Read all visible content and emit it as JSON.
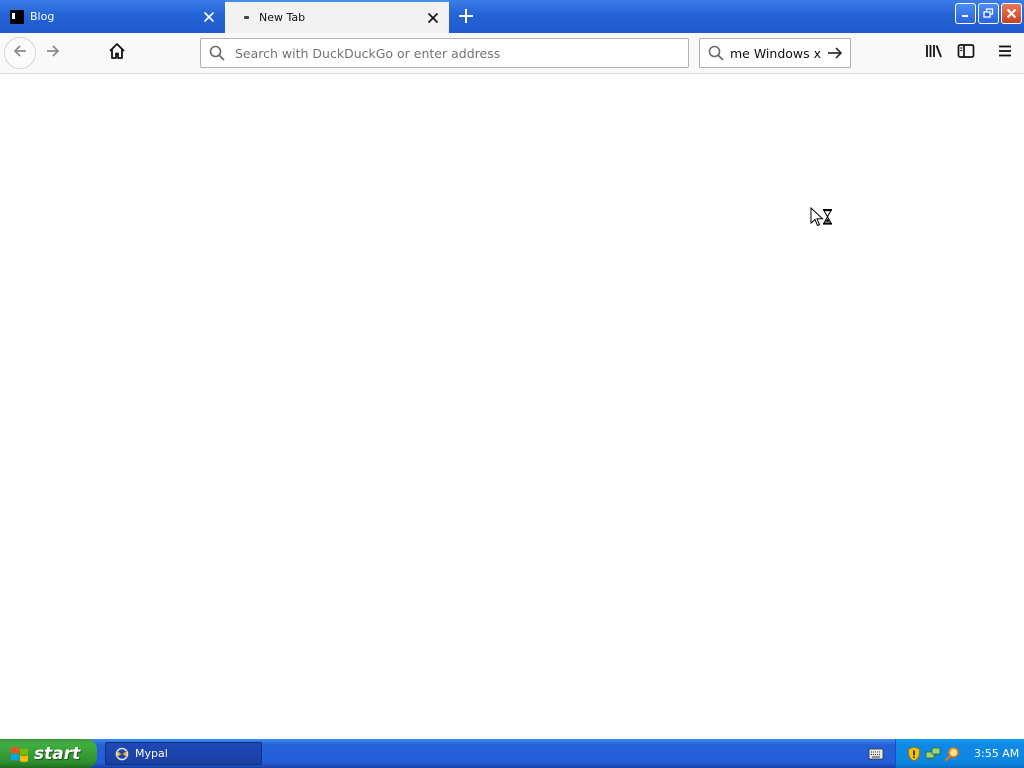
{
  "browser": {
    "tabs": [
      {
        "label": "Blog",
        "active": false
      },
      {
        "label": "New Tab",
        "active": true
      }
    ],
    "url_bar": {
      "placeholder": "Search with DuckDuckGo or enter address",
      "value": ""
    },
    "search_bar": {
      "value": "me Windows xp"
    },
    "icons": {
      "back": "arrow-left-icon",
      "forward": "arrow-right-icon",
      "home": "home-icon",
      "library": "library-icon",
      "sidebar": "sidebar-icon",
      "menu": "hamburger-menu-icon"
    }
  },
  "taskbar": {
    "start_label": "start",
    "tasks": [
      {
        "label": "Mypal"
      }
    ],
    "clock": "3:55 AM"
  },
  "colors": {
    "titlebar_blue": "#2463d6",
    "start_green": "#3fae3f",
    "tray_blue": "#0f8ae5"
  }
}
